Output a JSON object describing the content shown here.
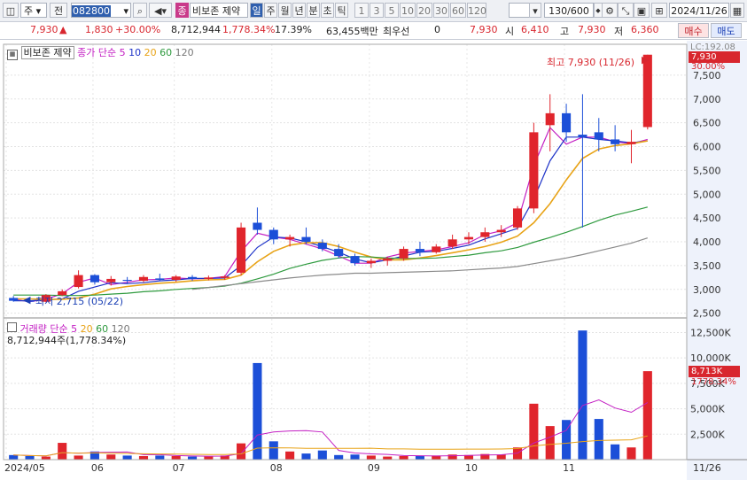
{
  "toolbar": {
    "market_type": "주",
    "period_mode": "전",
    "code": "082800",
    "badge": "종",
    "stock_name": "비보존 제약",
    "periods": [
      "일",
      "주",
      "월",
      "년",
      "분",
      "초",
      "틱"
    ],
    "intervals": [
      "1",
      "3",
      "5",
      "10",
      "20",
      "30",
      "60",
      "120"
    ],
    "count": "130/600",
    "date": "2024/11/26"
  },
  "quote": {
    "price": "7,930",
    "change": "1,830",
    "change_pct": "+30.00%",
    "volume": "8,712,944",
    "volume_pct": "1,778.34%",
    "turnover": "17.39%",
    "amount": "63,455백만",
    "best_label": "최우선",
    "best_value": "0",
    "bid": "7,930",
    "open_label": "시",
    "open": "6,410",
    "high_label": "고",
    "high": "7,930",
    "low_label": "저",
    "low": "6,360",
    "buy_label": "매수",
    "sell_label": "매도"
  },
  "price_legend": {
    "name": "비보존 제약",
    "ma_label": "종가 단순",
    "ma": [
      "5",
      "10",
      "20",
      "60",
      "120"
    ]
  },
  "volume_legend": {
    "name": "거래량",
    "ma_label": "단순",
    "ma": [
      "5",
      "20",
      "60",
      "120"
    ],
    "detail": "8,712,944주(1,778.34%)"
  },
  "annotations": {
    "high": "최고 7,930 (11/26)",
    "low": "최저 2,715 (05/22)",
    "lc": "LC:192.08",
    "last_price_tag": "7,930",
    "last_pct_tag": "30.00%",
    "last_vol_tag": "8,713K",
    "last_vol_pct_tag": "1778.34%"
  },
  "chart_data": {
    "type": "candlestick",
    "x_labels": [
      "2024/05",
      "06",
      "07",
      "08",
      "09",
      "10",
      "11",
      "11/26"
    ],
    "price_axis": {
      "ylim": [
        2400,
        8000
      ],
      "ticks": [
        "2,500",
        "3,000",
        "3,500",
        "4,000",
        "4,500",
        "5,000",
        "5,500",
        "6,000",
        "6,500",
        "7,000",
        "7,500"
      ]
    },
    "volume_axis": {
      "ylim": [
        0,
        13500000
      ],
      "ticks": [
        "2,500K",
        "5,000K",
        "7,500K",
        "10,000K",
        "12,500K"
      ]
    },
    "colors": {
      "up": "#e0252c",
      "down": "#1c4fd8",
      "ma5": "#c31fc3",
      "ma10": "#1e33c8",
      "ma20": "#e8a317",
      "ma60": "#2e9a3e",
      "ma120": "#8a8a8a"
    },
    "series": [
      {
        "name": "5",
        "values": [
          2790,
          2740,
          2790,
          2910,
          3150,
          3240,
          3100,
          3150,
          3200,
          3210,
          3240,
          3220,
          3230,
          3270,
          3800,
          4180,
          4100,
          4050,
          3950,
          3850,
          3700,
          3550,
          3550,
          3680,
          3760,
          3800,
          3830,
          3900,
          3980,
          4150,
          4230,
          4400,
          5600,
          6400,
          6050,
          6200,
          6200,
          6100,
          6060,
          6150
        ]
      },
      {
        "name": "10",
        "values": [
          2760,
          2760,
          2780,
          2800,
          2960,
          3050,
          3140,
          3120,
          3140,
          3180,
          3200,
          3230,
          3230,
          3240,
          3500,
          3880,
          4100,
          4080,
          4000,
          3900,
          3780,
          3640,
          3560,
          3620,
          3700,
          3780,
          3800,
          3860,
          3930,
          4060,
          4170,
          4280,
          4900,
          5700,
          6200,
          6200,
          6150,
          6120,
          6080,
          6120
        ]
      },
      {
        "name": "20",
        "values": [
          2800,
          2800,
          2790,
          2790,
          2820,
          2900,
          3010,
          3060,
          3100,
          3130,
          3150,
          3180,
          3200,
          3210,
          3300,
          3580,
          3800,
          3930,
          3980,
          3980,
          3900,
          3780,
          3680,
          3620,
          3620,
          3660,
          3710,
          3770,
          3830,
          3900,
          3990,
          4120,
          4400,
          4800,
          5300,
          5750,
          5950,
          6020,
          6060,
          6120
        ]
      },
      {
        "name": "60",
        "values": [
          2880,
          2880,
          2880,
          2870,
          2870,
          2880,
          2900,
          2920,
          2950,
          2970,
          3000,
          3020,
          3040,
          3070,
          3130,
          3220,
          3320,
          3440,
          3530,
          3610,
          3660,
          3690,
          3680,
          3660,
          3650,
          3650,
          3660,
          3690,
          3720,
          3770,
          3810,
          3880,
          3990,
          4090,
          4200,
          4320,
          4450,
          4560,
          4640,
          4730
        ]
      },
      {
        "name": "120",
        "values": [
          null,
          null,
          null,
          null,
          null,
          null,
          null,
          null,
          null,
          null,
          null,
          3000,
          3040,
          3080,
          3120,
          3160,
          3200,
          3240,
          3270,
          3300,
          3320,
          3340,
          3340,
          3350,
          3360,
          3370,
          3380,
          3390,
          3410,
          3430,
          3450,
          3480,
          3540,
          3600,
          3660,
          3730,
          3810,
          3890,
          3970,
          4080
        ]
      }
    ],
    "ohlc": [
      [
        2820,
        2860,
        2740,
        2760
      ],
      [
        2760,
        2790,
        2715,
        2740
      ],
      [
        2740,
        2900,
        2730,
        2880
      ],
      [
        2880,
        3000,
        2860,
        2960
      ],
      [
        3050,
        3400,
        3020,
        3300
      ],
      [
        3300,
        3320,
        3100,
        3150
      ],
      [
        3150,
        3280,
        3080,
        3220
      ],
      [
        3200,
        3260,
        3120,
        3180
      ],
      [
        3180,
        3300,
        3150,
        3260
      ],
      [
        3230,
        3330,
        3180,
        3200
      ],
      [
        3200,
        3300,
        3160,
        3270
      ],
      [
        3260,
        3300,
        3180,
        3220
      ],
      [
        3220,
        3290,
        3190,
        3250
      ],
      [
        3240,
        3300,
        3200,
        3270
      ],
      [
        3350,
        4400,
        3300,
        4300
      ],
      [
        4400,
        4720,
        4150,
        4250
      ],
      [
        4250,
        4300,
        3950,
        4050
      ],
      [
        4050,
        4150,
        3900,
        4100
      ],
      [
        4100,
        4300,
        3950,
        4000
      ],
      [
        3980,
        4050,
        3800,
        3850
      ],
      [
        3850,
        3950,
        3650,
        3700
      ],
      [
        3700,
        3750,
        3500,
        3550
      ],
      [
        3550,
        3650,
        3450,
        3600
      ],
      [
        3600,
        3680,
        3500,
        3650
      ],
      [
        3650,
        3900,
        3600,
        3850
      ],
      [
        3850,
        4000,
        3700,
        3780
      ],
      [
        3780,
        3950,
        3750,
        3900
      ],
      [
        3900,
        4150,
        3850,
        4050
      ],
      [
        4050,
        4200,
        3950,
        4100
      ],
      [
        4100,
        4300,
        4000,
        4200
      ],
      [
        4200,
        4350,
        4100,
        4250
      ],
      [
        4300,
        4750,
        4250,
        4700
      ],
      [
        4700,
        6500,
        4600,
        6300
      ],
      [
        6450,
        7100,
        5900,
        6700
      ],
      [
        6700,
        6900,
        6100,
        6300
      ],
      [
        6250,
        7100,
        4300,
        6200
      ],
      [
        6300,
        6600,
        5900,
        6150
      ],
      [
        6150,
        6450,
        5900,
        6050
      ],
      [
        6050,
        6350,
        5650,
        6100
      ],
      [
        6410,
        7930,
        6360,
        7930
      ]
    ],
    "volume": [
      450,
      350,
      300,
      1650,
      400,
      800,
      500,
      400,
      350,
      400,
      350,
      300,
      300,
      400,
      1600,
      9500,
      1800,
      800,
      600,
      900,
      450,
      500,
      400,
      300,
      350,
      350,
      400,
      500,
      450,
      550,
      500,
      1200,
      5500,
      3300,
      3900,
      12700,
      4000,
      1500,
      1200,
      8700
    ]
  }
}
